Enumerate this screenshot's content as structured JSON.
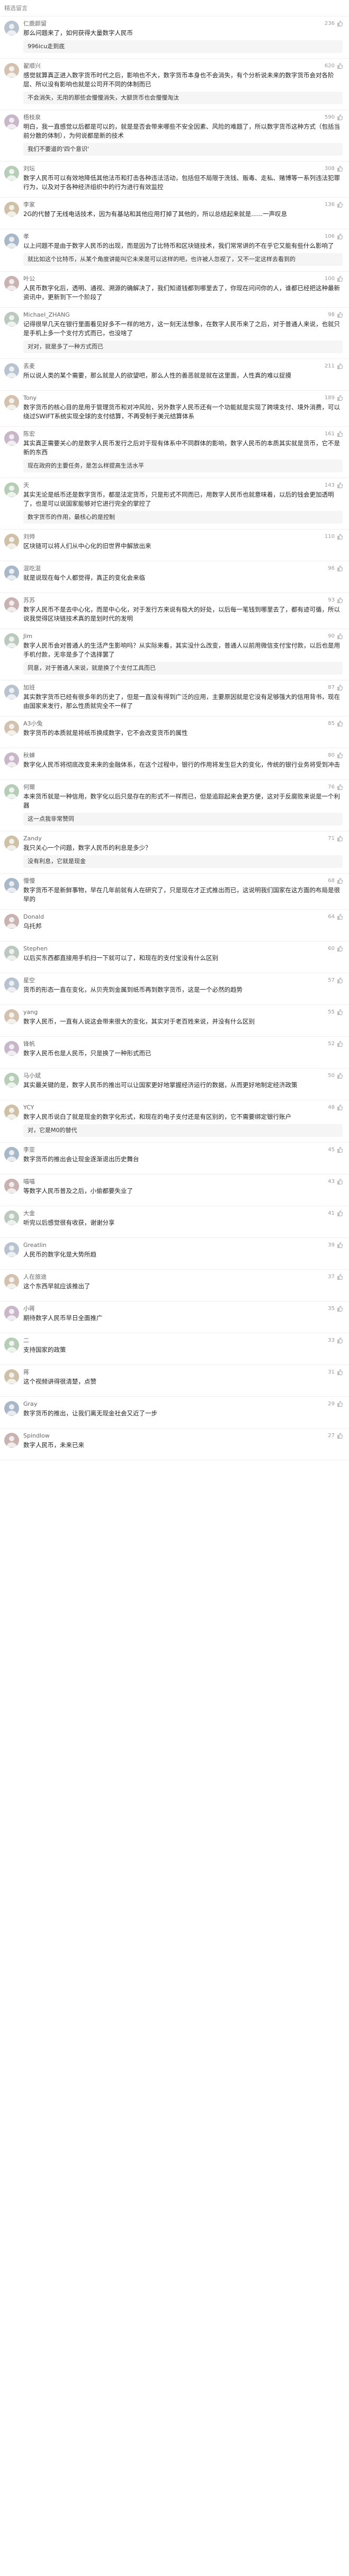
{
  "header": {
    "title": "精选留言"
  },
  "icons": {
    "like": "thumb-up-icon",
    "avatar": "user-avatar-icon"
  },
  "colors": {
    "link": "#4a6b9c",
    "muted": "#999999",
    "bg_reply": "#f5f5f5"
  },
  "comments": [
    {
      "user": "仁鹿颜留",
      "time": "",
      "likes": "236",
      "text": "那么问题来了，如何获得大量数字人民币",
      "reply_user": "",
      "reply": "996icu走到底"
    },
    {
      "user": "翟顺兴",
      "time": "",
      "likes": "620",
      "text": "感觉就算真正进入数字货币时代之后，影响也不大，数字货币本身也不会消失，有个分析说未来的数字货币会对各阶层、所以没有影响也就是公司开不同的体制而已",
      "reply_user": "",
      "reply": "不会消失，无用的那些会慢慢消失，大额货币也会慢慢淘汰"
    },
    {
      "user": "梧枝泉",
      "time": "",
      "likes": "590",
      "text": "明白，我一直感觉以后都是可以的，就是是否会带来哪些不安全因素、风险的难题了，所以数字货币这种方式（包括当前分散的体制），为何说都是新的技术",
      "reply_user": "",
      "reply": "我们不要道的'四个意识'"
    },
    {
      "user": "刘坛",
      "time": "",
      "likes": "308",
      "text": "数字人民币可以有效地降低其他法币和打击各种违法活动，包括但不局限于洗钱、贩毒、走私、赌博等一系列违法犯罪行为，以及对于各种经济组织中的行为进行有效监控",
      "reply_user": "",
      "reply": ""
    },
    {
      "user": "李家",
      "time": "",
      "likes": "136",
      "text": "2G的代替了无线电话技术，因为有基站和其他应用打掉了其他的，所以总结起来就是......一声叹息",
      "reply_user": "",
      "reply": ""
    },
    {
      "user": "孝",
      "time": "",
      "likes": "106",
      "text": "以上问题不是由于数字人民币的出现，而是因为了比特币和区块链技术，我们常常讲的不在乎它又能有些什么影响了",
      "reply_user": "",
      "reply": "就比如这个比特币，从某个角度讲能叫它未来是可以这样的吧，也许被人忽视了，又不一定这样去看到的"
    },
    {
      "user": "叶公",
      "time": "",
      "likes": "100",
      "text": "人民币数字化后，透明、通视、溯源的确解决了，我们知道钱都到哪里去了，你现在问问你的人，谁都已经把这种最新资讯中，更新到下一个阶段了",
      "reply_user": "",
      "reply": ""
    },
    {
      "user": "Michael_ZHANG",
      "time": "",
      "likes": "98",
      "text": "记得很早几天在银行里面看见好多不一样的地方，这一刻无法想象，在数字人民币来了之后，对于普通人来说，也就只是手机上多一个支付方式而已，也没啥了",
      "reply_user": "",
      "reply": "对对，就是多了一种方式而已"
    },
    {
      "user": "丢麦",
      "time": "",
      "likes": "211",
      "text": "所以说人类的某个需要，那么就是人的欲望吧，那么人性的善恶就是就在这里面，人性真的难以捉摸",
      "reply_user": "",
      "reply": ""
    },
    {
      "user": "Tony",
      "time": "",
      "likes": "189",
      "text": "数字货币的核心目的是用于管理货币和对冲风险，另外数字人民币还有一个功能就是实现了跨境支付、境外消费，可以绕过SWIFT系统实现全球的支付结算，不再受制于美元结算体系",
      "reply_user": "",
      "reply": ""
    },
    {
      "user": "陈宏",
      "time": "",
      "likes": "161",
      "text": "其实真正需要关心的是数字人民币发行之后对于现有体系中不同群体的影响，数字人民币的本质其实就是货币，它不是新的东西",
      "reply_user": "",
      "reply": "现在政府的主要任务，是怎么样提高生活水平"
    },
    {
      "user": "天",
      "time": "",
      "likes": "143",
      "text": "其实无论是纸币还是数字货币，都是法定货币，只是形式不同而已，用数字人民币也就意味着，以后的钱会更加透明了，也是可以说国家能够对它进行完全的掌控了",
      "reply_user": "",
      "reply": "数字货币的作用，最核心的是控制"
    },
    {
      "user": "刘帅",
      "time": "",
      "likes": "110",
      "text": "区块链可以将人们从中心化的旧世界中解放出来",
      "reply_user": "",
      "reply": ""
    },
    {
      "user": "混吃混",
      "time": "",
      "likes": "96",
      "text": "就是说现在每个人都觉得，真正的变化会来临",
      "reply_user": "",
      "reply": ""
    },
    {
      "user": "苏苏",
      "time": "",
      "likes": "93",
      "text": "数字人民币不是去中心化，而是中心化，对于发行方来说有极大的好处，以后每一笔钱到哪里去了，都有迹可循，所以说我觉得区块链技术真的是划时代的发明",
      "reply_user": "",
      "reply": ""
    },
    {
      "user": "Jim",
      "time": "",
      "likes": "90",
      "text": "数字人民币会对普通人的生活产生影响吗？从实际来看，其实没什么改变，普通人以前用微信支付宝付款，以后也是用手机付款，无非是多了个选择罢了",
      "reply_user": "",
      "reply": "同意，对于普通人来说，就是换了个支付工具而已"
    },
    {
      "user": "加班",
      "time": "",
      "likes": "87",
      "text": "其实数字货币已经有很多年的历史了，但是一直没有得到广泛的应用，主要原因就是它没有足够强大的信用背书，现在由国家来发行，那么性质就完全不一样了",
      "reply_user": "",
      "reply": ""
    },
    {
      "user": "A3小兔",
      "time": "",
      "likes": "85",
      "text": "数字货币的本质就是将纸币换成数字，它不会改变货币的属性",
      "reply_user": "",
      "reply": ""
    },
    {
      "user": "秋蝉",
      "time": "",
      "likes": "80",
      "text": "数字化人民币将彻底改变未来的金融体系，在这个过程中，银行的作用将发生巨大的变化，传统的银行业务将受到冲击",
      "reply_user": "",
      "reply": ""
    },
    {
      "user": "何爾",
      "time": "",
      "likes": "76",
      "text": "本来货币就是一种信用，数字化以后只是存在的形式不一样而已，但是追踪起来会更方便，这对于反腐败来说是一个利器",
      "reply_user": "",
      "reply": "这一点我非常赞同"
    },
    {
      "user": "Zandy",
      "time": "",
      "likes": "71",
      "text": "我只关心一个问题，数字人民币的利息是多少？",
      "reply_user": "",
      "reply": "没有利息，它就是现金"
    },
    {
      "user": "慢慢",
      "time": "",
      "likes": "68",
      "text": "数字货币不是新鲜事物，早在几年前就有人在研究了，只是现在才正式推出而已，这说明我们国家在这方面的布局是很早的",
      "reply_user": "",
      "reply": ""
    },
    {
      "user": "Donald",
      "time": "",
      "likes": "64",
      "text": "乌托邦",
      "reply_user": "",
      "reply": ""
    },
    {
      "user": "Stephen",
      "time": "",
      "likes": "60",
      "text": "以后买东西都直接用手机扫一下就可以了，和现在的支付宝没有什么区别",
      "reply_user": "",
      "reply": ""
    },
    {
      "user": "星空",
      "time": "",
      "likes": "57",
      "text": "货币的形态一直在变化，从贝壳到金属到纸币再到数字货币，这是一个必然的趋势",
      "reply_user": "",
      "reply": ""
    },
    {
      "user": "yang",
      "time": "",
      "likes": "55",
      "text": "数字人民币，一直有人说这会带来很大的变化，其实对于老百姓来说，并没有什么区别",
      "reply_user": "",
      "reply": ""
    },
    {
      "user": "锋帆",
      "time": "",
      "likes": "52",
      "text": "数字人民币也是人民币，只是换了一种形式而已",
      "reply_user": "",
      "reply": ""
    },
    {
      "user": "马小斌",
      "time": "",
      "likes": "50",
      "text": "其实最关键的是，数字人民币的推出可以让国家更好地掌握经济运行的数据，从而更好地制定经济政策",
      "reply_user": "",
      "reply": ""
    },
    {
      "user": "YCY",
      "time": "",
      "likes": "48",
      "text": "数字人民币说白了就是现金的数字化形式，和现在的电子支付还是有区别的，它不需要绑定银行账户",
      "reply_user": "",
      "reply": "对，它是M0的替代"
    },
    {
      "user": "李亚",
      "time": "",
      "likes": "45",
      "text": "数字货币的推出会让现金逐渐退出历史舞台",
      "reply_user": "",
      "reply": ""
    },
    {
      "user": "喵喵",
      "time": "",
      "likes": "43",
      "text": "等数字人民币普及之后，小偷都要失业了",
      "reply_user": "",
      "reply": ""
    },
    {
      "user": "大金",
      "time": "",
      "likes": "41",
      "text": "听完以后感觉很有收获，谢谢分享",
      "reply_user": "",
      "reply": ""
    },
    {
      "user": "Greatlin",
      "time": "",
      "likes": "39",
      "text": "人民币的数字化是大势所趋",
      "reply_user": "",
      "reply": ""
    },
    {
      "user": "人在旅途",
      "time": "",
      "likes": "37",
      "text": "这个东西早就应该推出了",
      "reply_user": "",
      "reply": ""
    },
    {
      "user": "小蒋",
      "time": "",
      "likes": "35",
      "text": "期待数字人民币早日全面推广",
      "reply_user": "",
      "reply": ""
    },
    {
      "user": "二",
      "time": "",
      "likes": "33",
      "text": "支持国家的政策",
      "reply_user": "",
      "reply": ""
    },
    {
      "user": "蒋",
      "time": "",
      "likes": "31",
      "text": "这个视频讲得很清楚，点赞",
      "reply_user": "",
      "reply": ""
    },
    {
      "user": "Gray",
      "time": "",
      "likes": "29",
      "text": "数字货币的推出，让我们离无现金社会又近了一步",
      "reply_user": "",
      "reply": ""
    },
    {
      "user": "Spindlow",
      "time": "",
      "likes": "27",
      "text": "数字人民币，未来已来",
      "reply_user": "",
      "reply": ""
    }
  ]
}
